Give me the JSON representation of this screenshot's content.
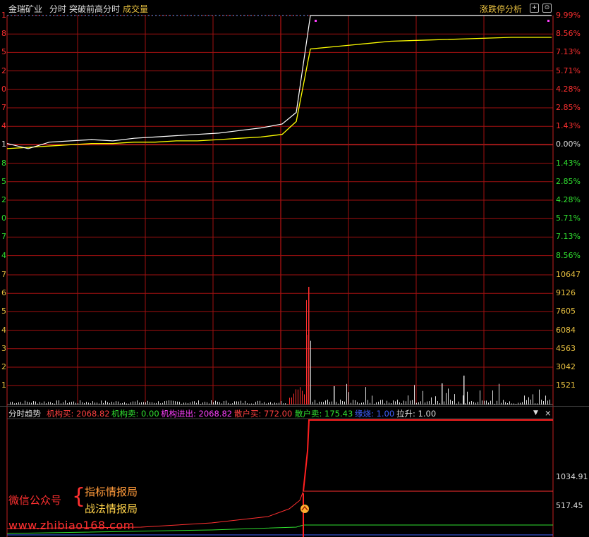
{
  "header": {
    "stock_name": "金瑞矿业",
    "mode": "分时",
    "indicator": "突破前高分时",
    "volume_label": "成交量",
    "analysis_button": "涨跌停分析",
    "plus_icon": "+",
    "settings_icon": "⊙"
  },
  "price_axis": {
    "right_labels": [
      "9.99%",
      "8.56%",
      "7.13%",
      "5.71%",
      "4.28%",
      "2.85%",
      "1.43%",
      "0.00%",
      "1.43%",
      "2.85%",
      "4.28%",
      "5.71%",
      "7.13%",
      "8.56%"
    ],
    "left_labels": [
      "1",
      "8",
      "5",
      "2",
      "0",
      "7",
      "4",
      "1",
      "8",
      "5",
      "2",
      "0",
      "7",
      "4"
    ]
  },
  "volume_axis": {
    "right_labels": [
      "10647",
      "9126",
      "7605",
      "6084",
      "4563",
      "3042",
      "1521"
    ],
    "left_labels": [
      "7",
      "6",
      "5",
      "4",
      "3",
      "2",
      "1"
    ]
  },
  "indicator_bar": {
    "name": "分时趋势",
    "inst_buy": "机构买: 2068.82",
    "inst_sell": "机构卖: 0.00",
    "inst_net": "机构进出: 2068.82",
    "retail_buy": "散户买: 772.00",
    "retail_sell": "散户卖: 175.43",
    "ignite": "缘烧: 1.00",
    "pull": "拉升: 1.00",
    "dropdown_icon": "▼",
    "close_icon": "×"
  },
  "indicator_axis": {
    "right_labels": [
      "1034.91",
      "517.45"
    ]
  },
  "watermark": {
    "wechat": "微信公众号",
    "name1": "指标情报局",
    "name2": "战法情报局",
    "url": "www.zhibiao168.com"
  },
  "colors": {
    "grid_red": "#a01010",
    "up_red": "#ff3030",
    "down_green": "#30e030",
    "price_line": "#ffffff",
    "avg_line": "#ffff00",
    "magenta": "#ff40ff",
    "blue": "#4060ff"
  },
  "chart_data": {
    "type": "line",
    "series": [
      {
        "values": [
          0.1,
          -0.3,
          0.2,
          0.3,
          0.4,
          0.3,
          0.5,
          0.6,
          0.7,
          0.8,
          0.9,
          1.1,
          1.3,
          1.6,
          2.5,
          9.99,
          9.99,
          9.99,
          9.99,
          9.99,
          9.99,
          9.99
        ]
      },
      {
        "values": [
          -0.3,
          -0.2,
          -0.1,
          0.0,
          0.1,
          0.1,
          0.2,
          0.2,
          0.3,
          0.3,
          0.4,
          0.5,
          0.6,
          0.8,
          1.8,
          7.4,
          7.7,
          8.0,
          8.1,
          8.2,
          8.3,
          8.3
        ]
      }
    ]
  }
}
